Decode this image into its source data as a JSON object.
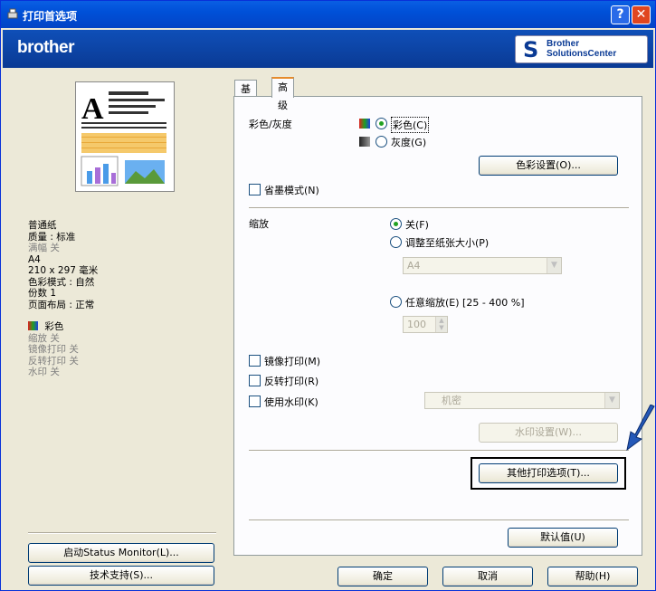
{
  "window": {
    "title": "打印首选项",
    "help_btn": "?",
    "close_btn": "✕"
  },
  "brand": {
    "logo": "brother",
    "solutions_line1": "Brother",
    "solutions_line2": "SolutionsCenter"
  },
  "summary": {
    "lines": [
      {
        "text": "普通纸",
        "grey": false
      },
      {
        "text": "质量 : 标准",
        "grey": false
      },
      {
        "text": "满幅 关",
        "grey": true
      },
      {
        "text": "A4",
        "grey": false
      },
      {
        "text": "210 x 297 毫米",
        "grey": false
      },
      {
        "text": "色彩模式 : 自然",
        "grey": false
      },
      {
        "text": "份数 1",
        "grey": false
      },
      {
        "text": "页面布局 : 正常",
        "grey": false
      }
    ],
    "color_line": "彩色",
    "lines2": [
      "缩放 关",
      "镜像打印 关",
      "反转打印 关",
      "水印 关"
    ]
  },
  "left_buttons": {
    "status_monitor": "启动Status Monitor(L)...",
    "tech_support": "技术支持(S)..."
  },
  "tabs": {
    "basic": "基本",
    "advanced": "高级"
  },
  "color": {
    "label": "彩色/灰度",
    "color_option": "彩色(C)",
    "gray_option": "灰度(G)",
    "settings_button": "色彩设置(O)..."
  },
  "toner_save": "省墨模式(N)",
  "scaling": {
    "label": "缩放",
    "off": "关(F)",
    "fit": "调整至纸张大小(P)",
    "paper_value": "A4",
    "free": "任意缩放(E) [25 - 400 %]",
    "percent_value": "100"
  },
  "mirror": "镜像打印(M)",
  "reverse": "反转打印(R)",
  "watermark": {
    "label": "使用水印(K)",
    "value": "机密",
    "settings_button": "水印设置(W)..."
  },
  "other_options_button": "其他打印选项(T)...",
  "default_button": "默认值(U)",
  "dialog_buttons": {
    "ok": "确定",
    "cancel": "取消",
    "help": "帮助(H)"
  },
  "colors": {
    "title_bar": "#0050d8",
    "brand_bar": "#0a3a94",
    "radio_dot": "#21a121"
  }
}
